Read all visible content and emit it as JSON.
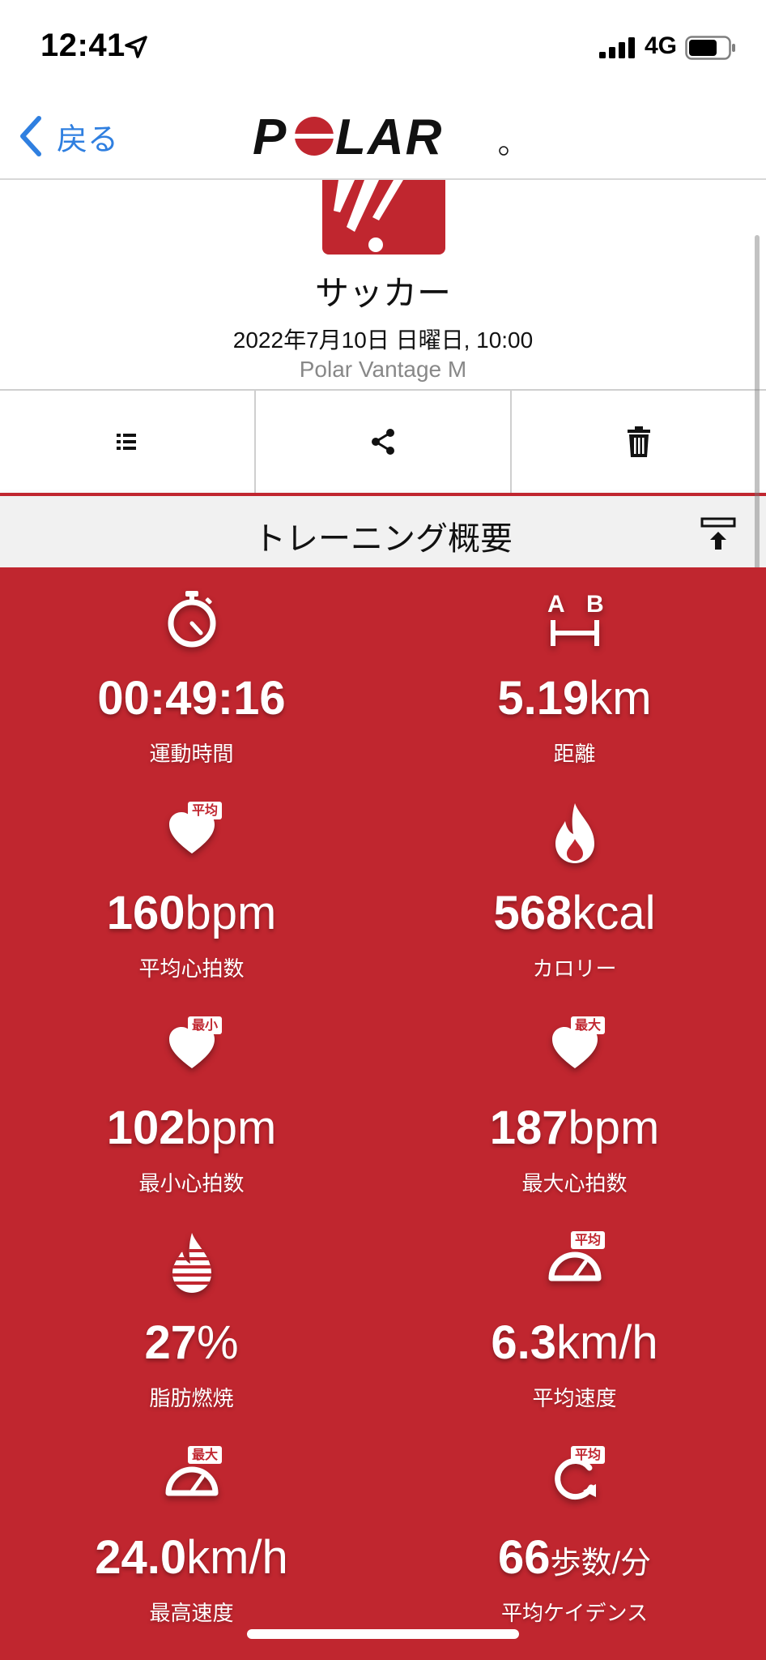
{
  "status_bar": {
    "time": "12:41",
    "network": "4G"
  },
  "nav": {
    "back_label": "戻る",
    "logo_text": "POLAR"
  },
  "header": {
    "sport_name": "サッカー",
    "date_time": "2022年7月10日 日曜日, 10:00",
    "device": "Polar Vantage M"
  },
  "actions": [
    {
      "name": "list",
      "icon": "list-icon"
    },
    {
      "name": "share",
      "icon": "share-icon"
    },
    {
      "name": "delete",
      "icon": "trash-icon"
    }
  ],
  "section": {
    "title": "トレーニング概要"
  },
  "stats": {
    "duration": {
      "value": "00:49:16",
      "unit": "",
      "label": "運動時間",
      "icon": "stopwatch-icon"
    },
    "distance": {
      "value": "5.19",
      "unit": "km",
      "label": "距離",
      "icon": "distance-ab-icon"
    },
    "avg_hr": {
      "value": "160",
      "unit": "bpm",
      "label": "平均心拍数",
      "badge": "平均",
      "icon": "heart-icon"
    },
    "calories": {
      "value": "568",
      "unit": "kcal",
      "label": "カロリー",
      "icon": "flame-icon"
    },
    "min_hr": {
      "value": "102",
      "unit": "bpm",
      "label": "最小心拍数",
      "badge": "最小",
      "icon": "heart-icon"
    },
    "max_hr": {
      "value": "187",
      "unit": "bpm",
      "label": "最大心拍数",
      "badge": "最大",
      "icon": "heart-icon"
    },
    "fat_burn": {
      "value": "27",
      "unit": "%",
      "label": "脂肪燃焼",
      "icon": "fat-burn-icon"
    },
    "avg_speed": {
      "value": "6.3",
      "unit": "km/h",
      "label": "平均速度",
      "badge": "平均",
      "icon": "speedometer-icon"
    },
    "max_speed": {
      "value": "24.0",
      "unit": "km/h",
      "label": "最高速度",
      "badge": "最大",
      "icon": "speedometer-icon"
    },
    "avg_cadence": {
      "value": "66",
      "unit": "歩数/分",
      "label": "平均ケイデンス",
      "badge": "平均",
      "icon": "cadence-icon"
    }
  },
  "colors": {
    "brand_red": "#c0262f",
    "ios_blue": "#2f7fe0"
  }
}
